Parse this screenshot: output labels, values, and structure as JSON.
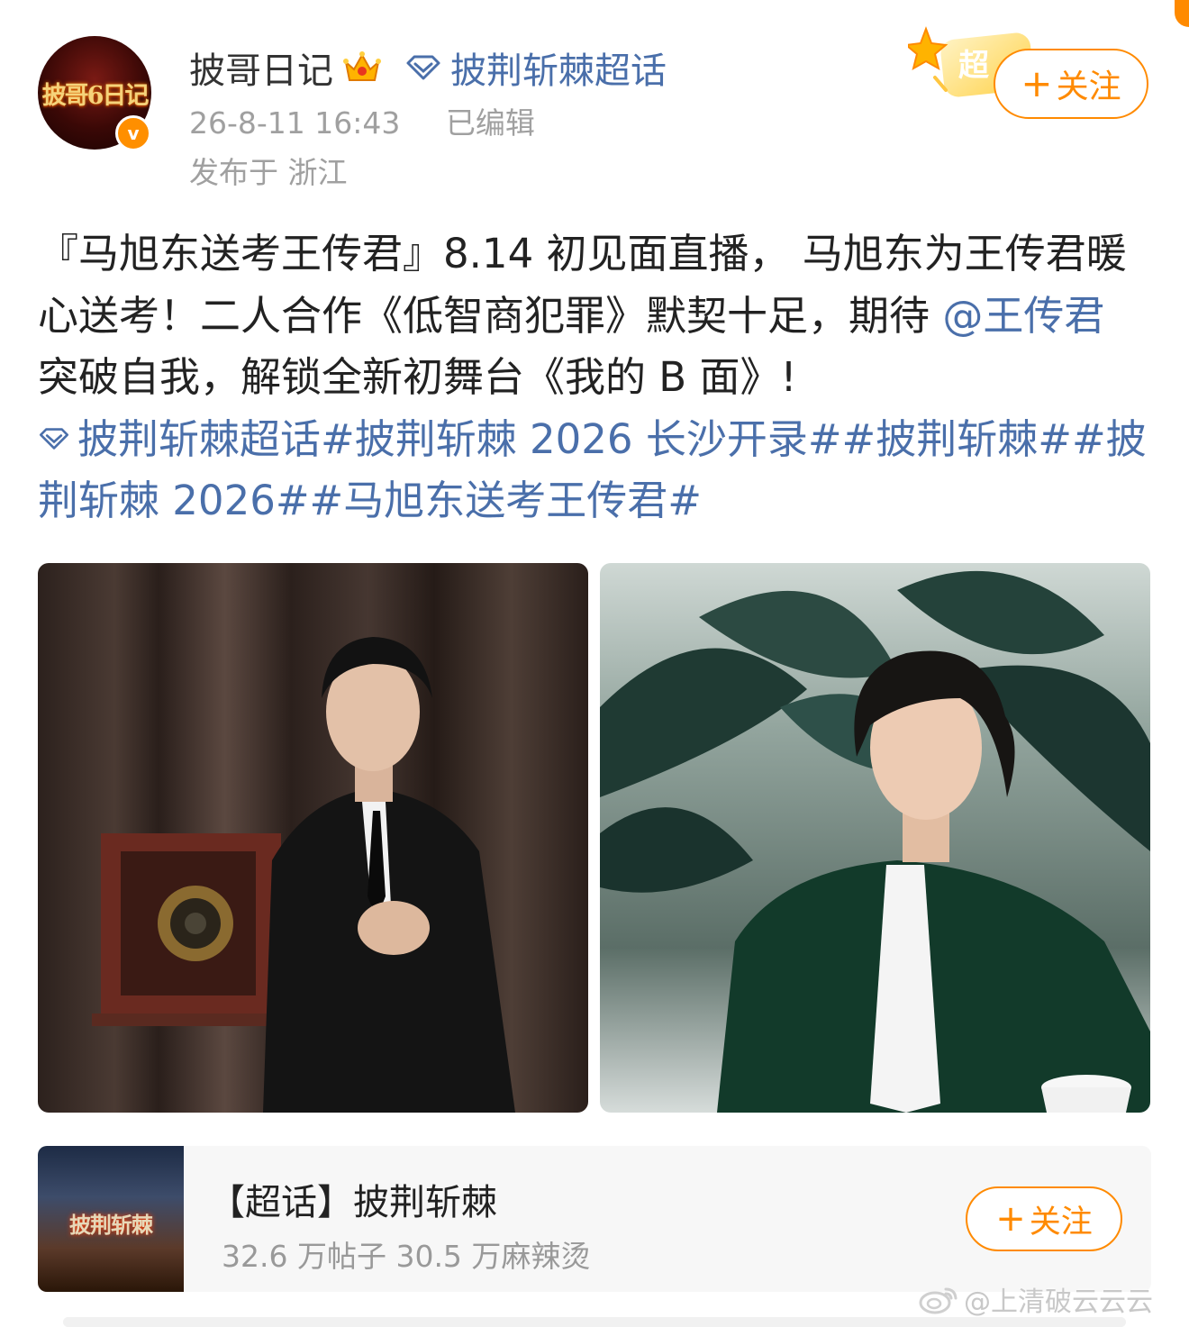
{
  "post": {
    "author": {
      "name": "披哥日记",
      "avatar_logo": "披哥6日记",
      "verified_mark": "v"
    },
    "supertopic_link": "披荆斩棘超话",
    "timestamp": "26-8-11 16:43",
    "edited": "已编辑",
    "location": "发布于 浙江",
    "chao_badge": "超",
    "follow_button": {
      "plus": "+",
      "label": "关注"
    },
    "text": {
      "line_part1": "『马旭东送考王传君』8.14 初见面直播， 马旭东为王传君暖心送考！二人合作《低智商犯罪》默契十足，期待 ",
      "mention": "@王传君",
      "line_part2": " 突破自我，解锁全新初舞台《我的 B 面》!",
      "tags": "披荆斩棘超话#披荆斩棘 2026 长沙开录##披荆斩棘##披荆斩棘 2026##马旭东送考王传君#"
    },
    "images": [
      {
        "icon": "photo-man-in-suit-with-camera"
      },
      {
        "icon": "photo-man-in-green-shirt-with-plants"
      }
    ]
  },
  "topic_card": {
    "thumb_logo": "披荆斩棘",
    "title": "【超话】披荆斩棘",
    "stats": "32.6 万帖子 30.5 万麻辣烫",
    "follow_button": {
      "plus": "+",
      "label": "关注"
    }
  },
  "watermark": "@上清破云云云",
  "colors": {
    "accent_orange": "#ff8a00",
    "link_blue": "#4a6faa",
    "meta_gray": "#a0a0a0"
  }
}
